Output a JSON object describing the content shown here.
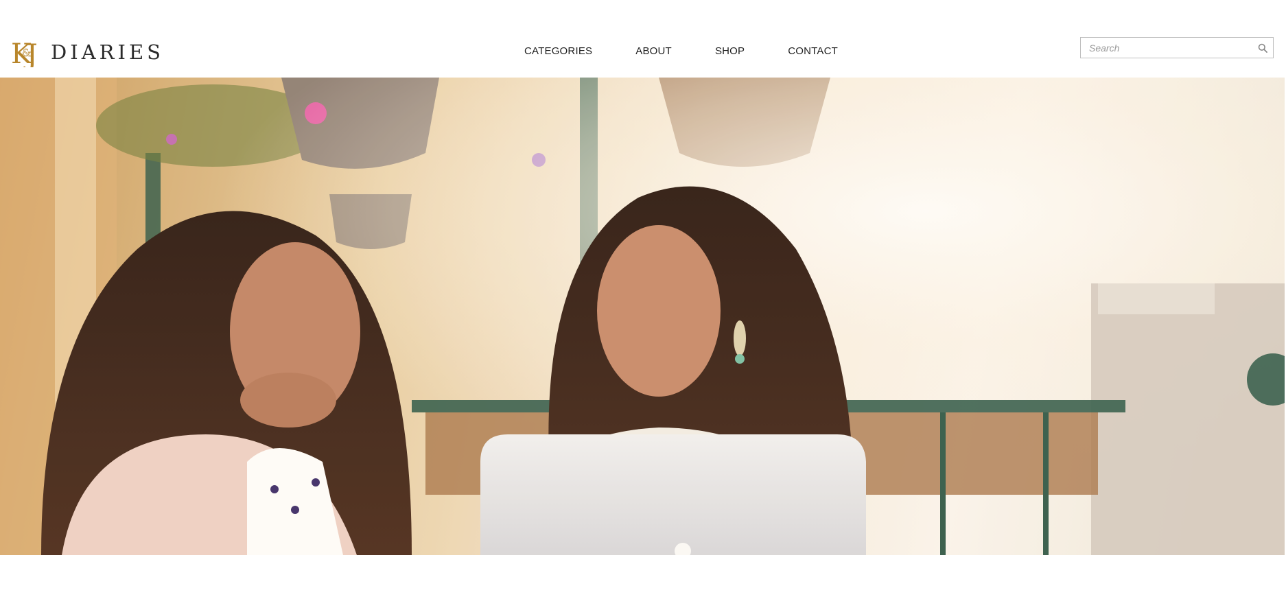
{
  "brand": {
    "mark_text": "K&J",
    "name": "DIARIES",
    "gold_color": "#b8862b"
  },
  "nav": {
    "items": [
      {
        "label": "CATEGORIES"
      },
      {
        "label": "ABOUT"
      },
      {
        "label": "SHOP"
      },
      {
        "label": "CONTACT"
      }
    ]
  },
  "search": {
    "placeholder": "Search",
    "value": "",
    "icon": "magnifier-icon"
  },
  "hero": {
    "image": "hero-photo",
    "accent_colors": [
      "#c99a5a",
      "#f6eadb",
      "#2f5a4a"
    ]
  }
}
